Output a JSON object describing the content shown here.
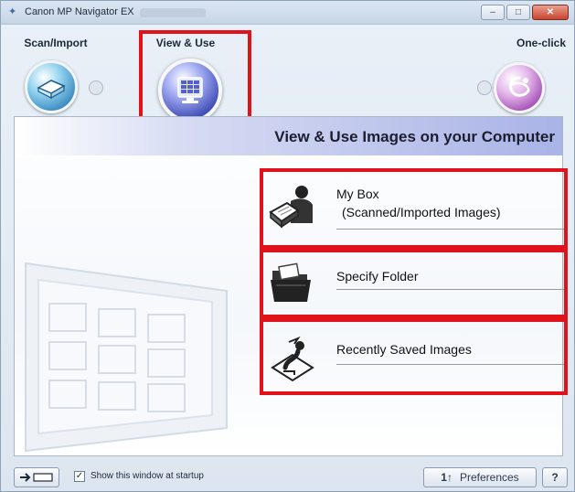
{
  "window": {
    "title": "Canon MP Navigator EX",
    "minimize_label": "–",
    "maximize_label": "□",
    "close_label": "✕"
  },
  "topnav": {
    "modes": [
      {
        "label": "Scan/Import",
        "icon": "scanner-icon"
      },
      {
        "label": "View & Use",
        "icon": "monitor-icon",
        "selected": true
      },
      {
        "label": "One-click",
        "icon": "one-click-icon"
      }
    ]
  },
  "panel": {
    "title": "View & Use Images on your Computer",
    "options": [
      {
        "line1": "My Box",
        "line2": "(Scanned/Imported Images)",
        "icon": "person-box-icon"
      },
      {
        "line1": "Specify Folder",
        "icon": "folder-icon"
      },
      {
        "line1": "Recently Saved Images",
        "icon": "recent-images-icon"
      }
    ]
  },
  "bottombar": {
    "show_at_startup_label": "Show this window at startup",
    "show_at_startup_checked": true,
    "preferences_label": "Preferences",
    "help_label": "?"
  },
  "colors": {
    "highlight": "#e0121a",
    "header_gradient_end": "#a9b3e6",
    "view_orb": "#2c3aa8",
    "scan_orb": "#2b7fb8",
    "oneclick_orb": "#9b3fae"
  }
}
